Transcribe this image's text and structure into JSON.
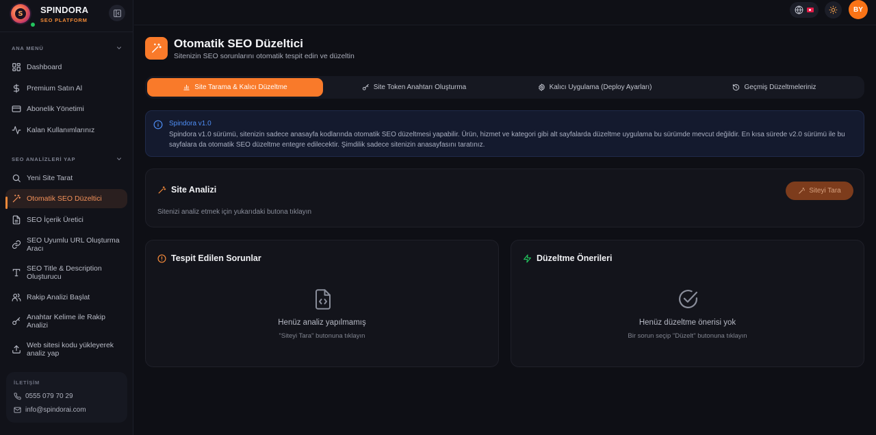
{
  "brand": {
    "name": "SPINDORA",
    "subtitle": "SEO PLATFORM",
    "logo_letter": "S"
  },
  "sidebar": {
    "section_main": "ANA MENÜ",
    "main_items": [
      {
        "label": "Dashboard",
        "icon": "dashboard-grid-icon"
      },
      {
        "label": "Premium Satın Al",
        "icon": "dollar-icon"
      },
      {
        "label": "Abonelik Yönetimi",
        "icon": "credit-card-icon"
      },
      {
        "label": "Kalan Kullanımlarınız",
        "icon": "activity-icon"
      }
    ],
    "section_seo": "SEO ANALİZLERİ YAP",
    "seo_items": [
      {
        "label": "Yeni Site Tarat",
        "icon": "search-icon"
      },
      {
        "label": "Otomatik SEO Düzeltici",
        "icon": "magic-wand-icon",
        "active": true
      },
      {
        "label": "SEO İçerik Üretici",
        "icon": "document-icon"
      },
      {
        "label": "SEO Uyumlu URL Oluşturma Aracı",
        "icon": "link-icon"
      },
      {
        "label": "SEO Title & Description Oluşturucu",
        "icon": "text-icon"
      },
      {
        "label": "Rakip Analizi Başlat",
        "icon": "users-icon"
      },
      {
        "label": "Anahtar Kelime ile Rakip Analizi",
        "icon": "key-icon"
      },
      {
        "label": "Web sitesi kodu yükleyerek analiz yap",
        "icon": "upload-icon"
      }
    ],
    "contact": {
      "title": "İLETİŞİM",
      "phone": "0555 079 70 29",
      "email": "info@spindorai.com"
    }
  },
  "topbar": {
    "avatar_initials": "BY",
    "accent": "#f97316"
  },
  "page": {
    "title": "Otomatik SEO Düzeltici",
    "subtitle": "Sitenizin SEO sorunlarını otomatik tespit edin ve düzeltin"
  },
  "tabs": [
    {
      "label": "Site Tarama & Kalıcı Düzeltme",
      "icon": "bar-chart-icon",
      "active": true
    },
    {
      "label": "Site Token Anahtarı Oluşturma",
      "icon": "key-icon"
    },
    {
      "label": "Kalıcı Uygulama (Deploy Ayarları)",
      "icon": "gear-icon"
    },
    {
      "label": "Geçmiş Düzeltmeleriniz",
      "icon": "history-icon"
    }
  ],
  "info": {
    "title": "Spindora v1.0",
    "text": "Spindora v1.0 sürümü, sitenizin sadece anasayfa kodlarında otomatik SEO düzeltmesi yapabilir. Ürün, hizmet ve kategori gibi alt sayfalarda düzeltme uygulama bu sürümde mevcut değildir. En kısa sürede v2.0 sürümü ile bu sayfalara da otomatik SEO düzeltme entegre edilecektir. Şimdilik sadece sitenizin anasayfasını taratınız."
  },
  "analysis": {
    "title": "Site Analizi",
    "button": "Siteyi Tara",
    "hint": "Sitenizi analiz etmek için yukarıdaki butona tıklayın"
  },
  "issues": {
    "title": "Tespit Edilen Sorunlar",
    "empty_title": "Henüz analiz yapılmamış",
    "empty_sub": "\"Siteyi Tara\" butonuna tıklayın"
  },
  "fixes": {
    "title": "Düzeltme Önerileri",
    "empty_title": "Henüz düzeltme önerisi yok",
    "empty_sub": "Bir sorun seçip \"Düzelt\" butonuna tıklayın"
  }
}
